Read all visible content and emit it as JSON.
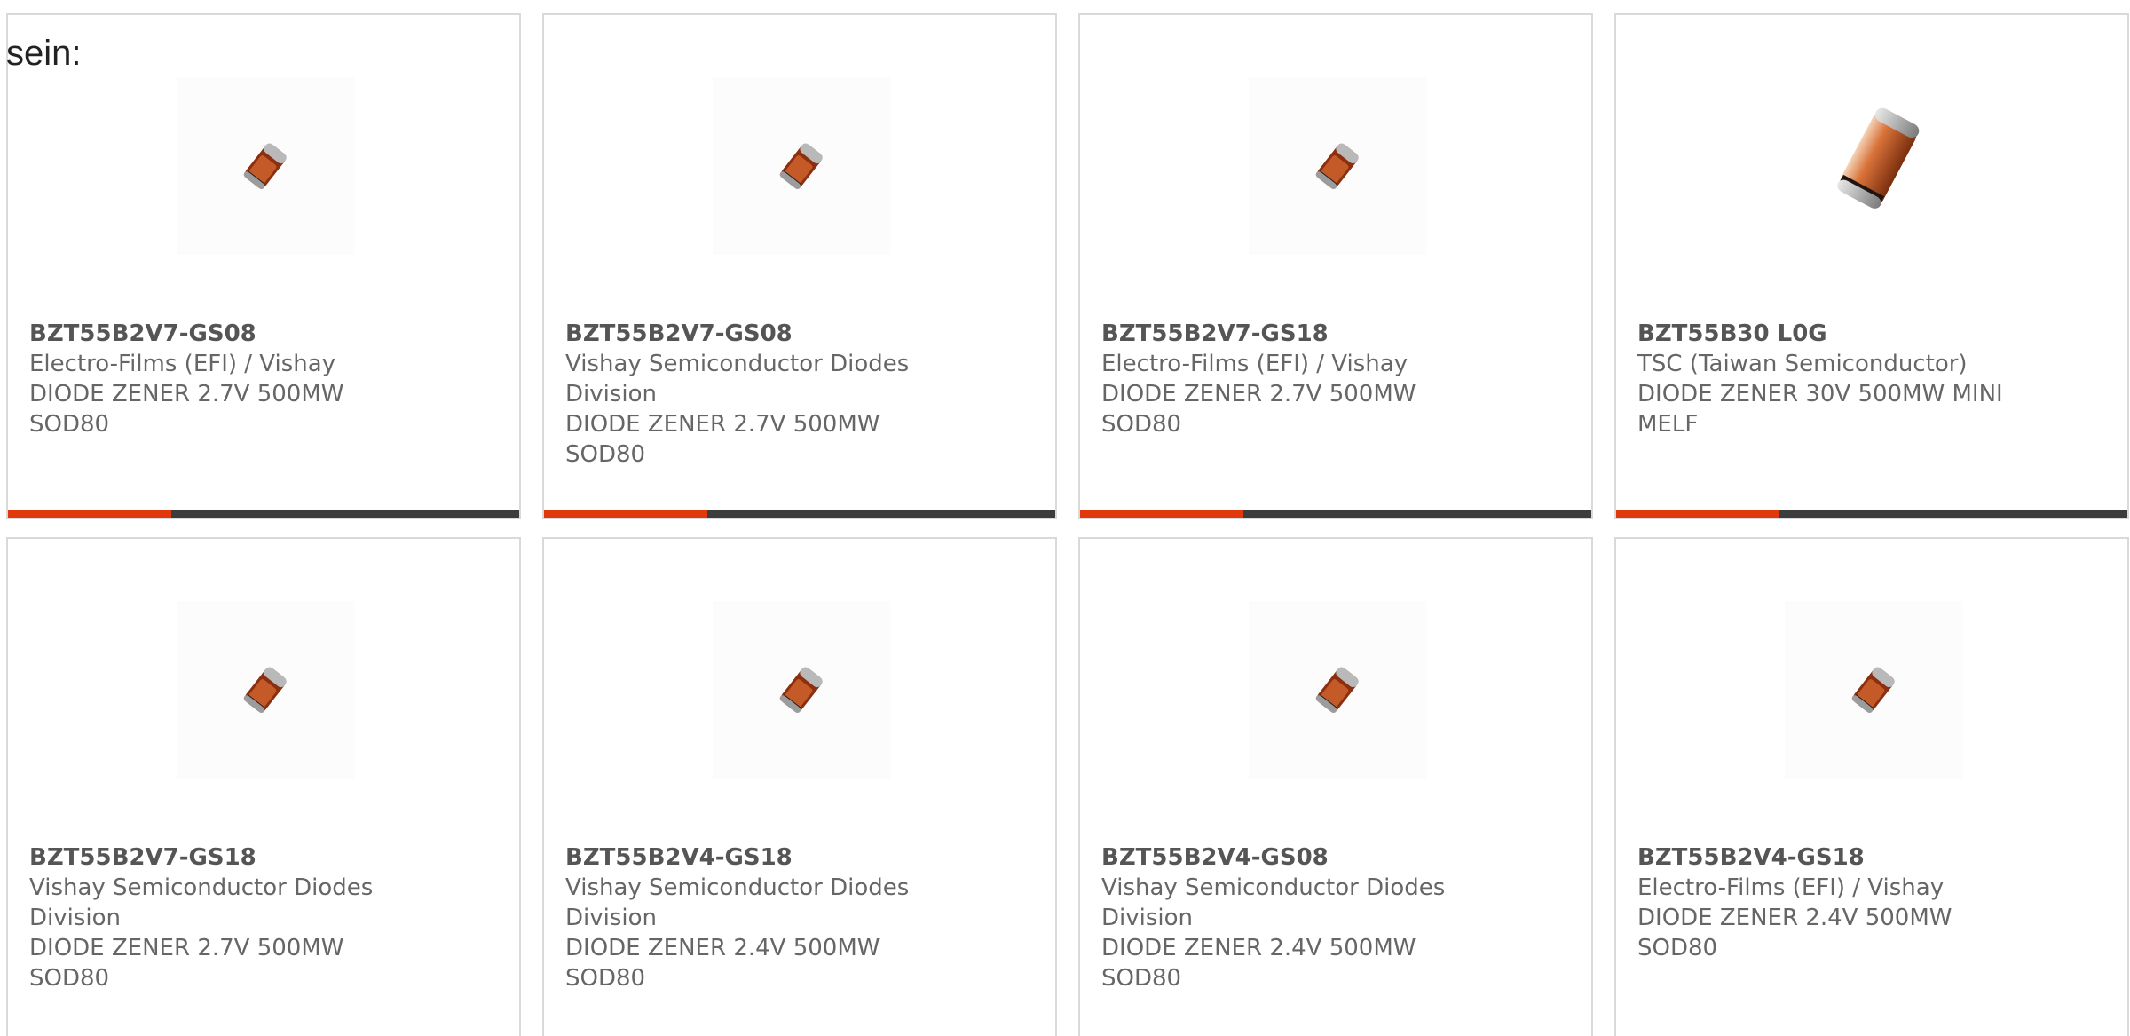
{
  "intro_text": "sein:",
  "colors": {
    "accent": "#e03a0c",
    "bar_track": "#3c3c3c",
    "card_border": "#d9d9d9",
    "text": "#666666"
  },
  "products": [
    {
      "part_number": "BZT55B2V7-GS08",
      "manufacturer": "Electro-Films (EFI) / Vishay",
      "description": "DIODE ZENER 2.7V 500MW SOD80",
      "image": "glass-melf-diode-small",
      "progress": 0.32
    },
    {
      "part_number": "BZT55B2V7-GS08",
      "manufacturer": "Vishay Semiconductor Diodes Division",
      "description": "DIODE ZENER 2.7V 500MW SOD80",
      "image": "glass-melf-diode-small",
      "progress": 0.32
    },
    {
      "part_number": "BZT55B2V7-GS18",
      "manufacturer": "Electro-Films (EFI) / Vishay",
      "description": "DIODE ZENER 2.7V 500MW SOD80",
      "image": "glass-melf-diode-small",
      "progress": 0.32
    },
    {
      "part_number": "BZT55B30 L0G",
      "manufacturer": "TSC (Taiwan Semiconductor)",
      "description": "DIODE ZENER 30V 500MW MINI MELF",
      "image": "glass-melf-diode-large",
      "progress": 0.32
    },
    {
      "part_number": "BZT55B2V7-GS18",
      "manufacturer": "Vishay Semiconductor Diodes Division",
      "description": "DIODE ZENER 2.7V 500MW SOD80",
      "image": "glass-melf-diode-small"
    },
    {
      "part_number": "BZT55B2V4-GS18",
      "manufacturer": "Vishay Semiconductor Diodes Division",
      "description": "DIODE ZENER 2.4V 500MW SOD80",
      "image": "glass-melf-diode-small"
    },
    {
      "part_number": "BZT55B2V4-GS08",
      "manufacturer": "Vishay Semiconductor Diodes Division",
      "description": "DIODE ZENER 2.4V 500MW SOD80",
      "image": "glass-melf-diode-small"
    },
    {
      "part_number": "BZT55B2V4-GS18",
      "manufacturer": "Electro-Films (EFI) / Vishay",
      "description": "DIODE ZENER 2.4V 500MW SOD80",
      "image": "glass-melf-diode-small"
    }
  ]
}
